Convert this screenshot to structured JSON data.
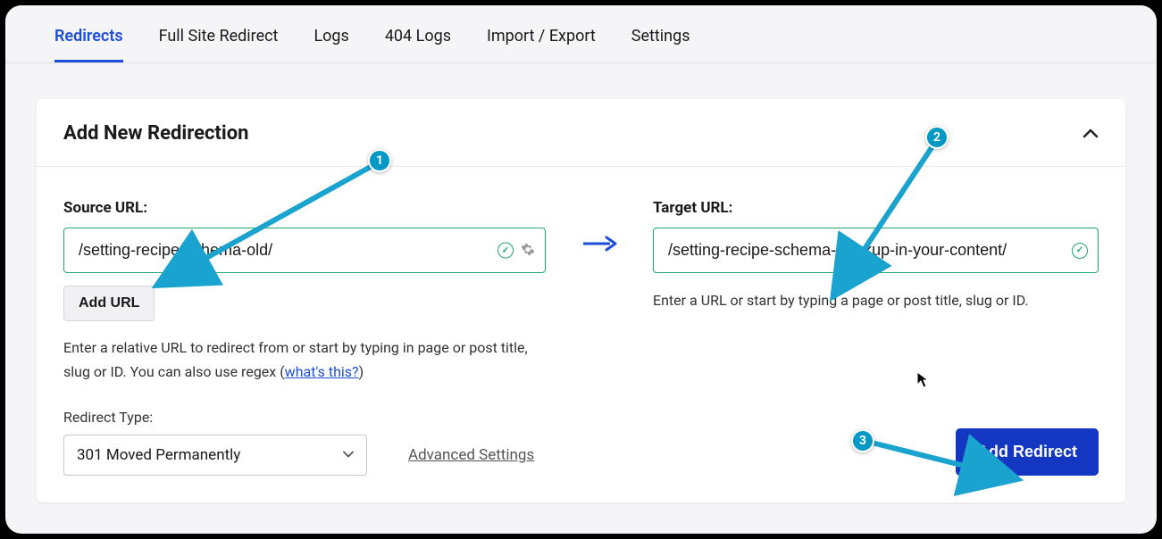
{
  "tabs": {
    "items": [
      "Redirects",
      "Full Site Redirect",
      "Logs",
      "404 Logs",
      "Import / Export",
      "Settings"
    ],
    "activeIndex": 0
  },
  "card": {
    "title": "Add New Redirection"
  },
  "source": {
    "label": "Source URL:",
    "value": "/setting-recipe-schema-old/",
    "addUrlLabel": "Add URL",
    "hint_before": "Enter a relative URL to redirect from or start by typing in page or post title, slug or ID. You can also use regex (",
    "hint_link": "what's this?",
    "hint_after": ")"
  },
  "target": {
    "label": "Target URL:",
    "value": "/setting-recipe-schema-markup-in-your-content/",
    "hint": "Enter a URL or start by typing a page or post title, slug or ID."
  },
  "redirectType": {
    "label": "Redirect Type:",
    "value": "301 Moved Permanently",
    "advancedLabel": "Advanced Settings"
  },
  "actions": {
    "addRedirectLabel": "Add Redirect"
  },
  "annotations": {
    "b1": "1",
    "b2": "2",
    "b3": "3"
  }
}
